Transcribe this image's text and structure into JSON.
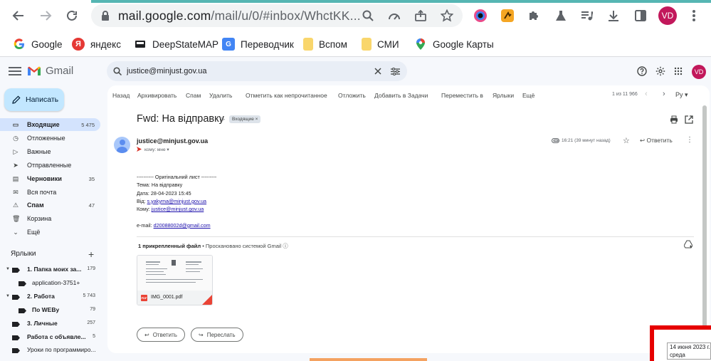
{
  "browser": {
    "url_host": "mail.google.com",
    "url_path": "/mail/u/0/#inbox/WhctKK...",
    "profile_initials": "VD"
  },
  "bookmarks": [
    {
      "label": "Google",
      "icon": "google-g-icon",
      "color": "#4285f4"
    },
    {
      "label": "яндекс",
      "icon": "yandex-icon",
      "color": "#e53935"
    },
    {
      "label": "DeepStateMAP",
      "icon": "deepstate-icon",
      "color": "#202124"
    },
    {
      "label": "Переводчик",
      "icon": "translate-icon",
      "color": "#4285f4"
    },
    {
      "label": "Вспом",
      "icon": "folder-icon",
      "color": "#f9d66c"
    },
    {
      "label": "СМИ",
      "icon": "folder-icon",
      "color": "#f9d66c"
    },
    {
      "label": "Google Карты",
      "icon": "maps-pin-icon",
      "color": "#34a853"
    }
  ],
  "gmail": {
    "wordmark": "Gmail",
    "search_value": "justice@minjust.gov.ua",
    "avatar_initials": "VD"
  },
  "sidebar": {
    "compose": "Написать",
    "items": [
      {
        "label": "Входящие",
        "count": "5 475",
        "icon": "inbox-icon",
        "active": true
      },
      {
        "label": "Отложенные",
        "count": "",
        "icon": "clock-icon"
      },
      {
        "label": "Важные",
        "count": "",
        "icon": "important-icon"
      },
      {
        "label": "Отправленные",
        "count": "",
        "icon": "send-icon"
      },
      {
        "label": "Черновики",
        "count": "35",
        "icon": "draft-icon",
        "bold": true
      },
      {
        "label": "Вся почта",
        "count": "",
        "icon": "all-mail-icon"
      },
      {
        "label": "Спам",
        "count": "47",
        "icon": "spam-icon",
        "bold": true
      },
      {
        "label": "Корзина",
        "count": "",
        "icon": "trash-icon"
      },
      {
        "label": "Ещё",
        "count": "",
        "icon": "chevron-down-icon"
      }
    ],
    "labels_heading": "Ярлыки",
    "labels": [
      {
        "label": "1. Папка моих за...",
        "count": "179",
        "bold": true,
        "expandable": true,
        "indent": 0
      },
      {
        "label": "application-3751+",
        "count": "",
        "bold": false,
        "expandable": false,
        "indent": 1
      },
      {
        "label": "2. Работа",
        "count": "5 743",
        "bold": true,
        "expandable": true,
        "indent": 0
      },
      {
        "label": "По WEBу",
        "count": "79",
        "bold": true,
        "expandable": false,
        "indent": 1
      },
      {
        "label": "3. Личные",
        "count": "257",
        "bold": true,
        "expandable": false,
        "indent": 0
      },
      {
        "label": "Работа с объявле...",
        "count": "5",
        "bold": true,
        "expandable": false,
        "indent": 0
      },
      {
        "label": "Уроки по программиро...",
        "count": "",
        "bold": false,
        "expandable": false,
        "indent": 0
      }
    ]
  },
  "toolbar": {
    "actions": [
      "Назад",
      "Архивировать",
      "Спам",
      "Удалить",
      "Отметить как непрочитанное",
      "Отложить",
      "Добавить в Задачи",
      "Переместить в",
      "Ярлыки",
      "Ещё"
    ],
    "pager_text": "1 из 11 966",
    "input_tools": "Ру"
  },
  "email": {
    "subject": "Fwd: На відправку",
    "inbox_chip": "Входящие ×",
    "sender": "justice@minjust.gov.ua",
    "to_me": "кому: мне",
    "time": "16:21 (39 минут назад)",
    "reply_label": "Ответить",
    "body": {
      "line_forward": "---------- Оригінальний лист ---------",
      "subject_line": "Тема: На відправку",
      "date_line": "Дата: 28-04-2023 15:45",
      "from_prefix": "Від: ",
      "from_email": "s.yakyma@minjust.gov.ua",
      "to_prefix": "Кому: ",
      "to_email": "justice@minjust.gov.ua",
      "email_prefix": "e-mail: ",
      "email_value": "d20088002d@gmail.com"
    },
    "attachments_heading": "1 прикрепленный файл",
    "attachments_scanned": " • Проскановано системой Gmail",
    "attachment_name": "IMG_0001.pdf",
    "attachment_badge": "PDF",
    "reply_button": "Ответить",
    "forward_button": "Переслать"
  },
  "taskbar_tooltip": {
    "date": "14 июня 2023 г.",
    "weekday": "среда"
  }
}
